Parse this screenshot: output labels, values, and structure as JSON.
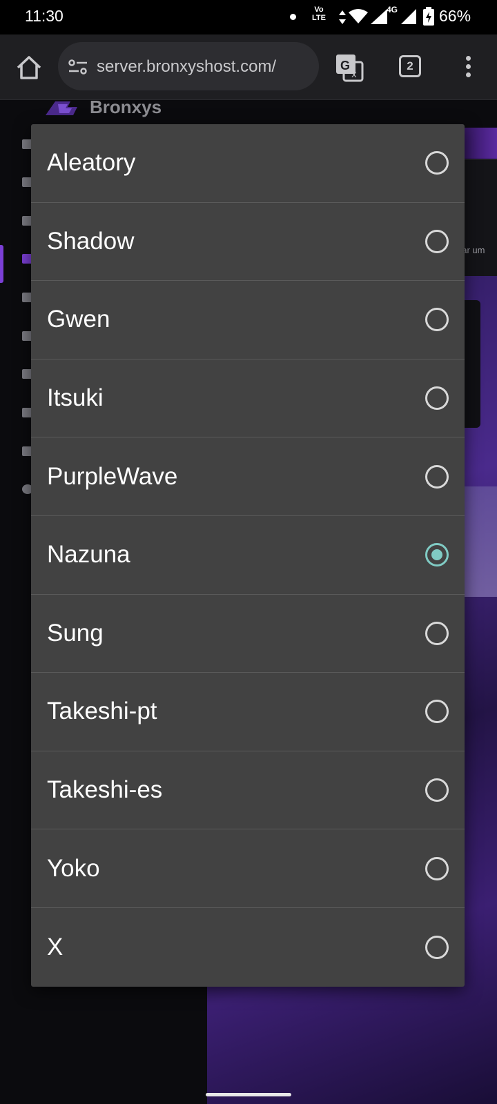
{
  "status_bar": {
    "time": "11:30",
    "volte_top": "Vo",
    "volte_bottom": "LTE",
    "network_type": "4G",
    "battery": "66%"
  },
  "browser": {
    "url": "server.bronxyshost.com/",
    "tab_count": "2"
  },
  "background_page": {
    "logo_text": "Bronxys",
    "partial_text": "nar um"
  },
  "dialog": {
    "options": [
      {
        "label": "Aleatory",
        "selected": false
      },
      {
        "label": "Shadow",
        "selected": false
      },
      {
        "label": "Gwen",
        "selected": false
      },
      {
        "label": "Itsuki",
        "selected": false
      },
      {
        "label": "PurpleWave",
        "selected": false
      },
      {
        "label": "Nazuna",
        "selected": true
      },
      {
        "label": "Sung",
        "selected": false
      },
      {
        "label": "Takeshi-pt",
        "selected": false
      },
      {
        "label": "Takeshi-es",
        "selected": false
      },
      {
        "label": "Yoko",
        "selected": false
      },
      {
        "label": "X",
        "selected": false
      }
    ],
    "accent_color": "#80cbc4"
  }
}
